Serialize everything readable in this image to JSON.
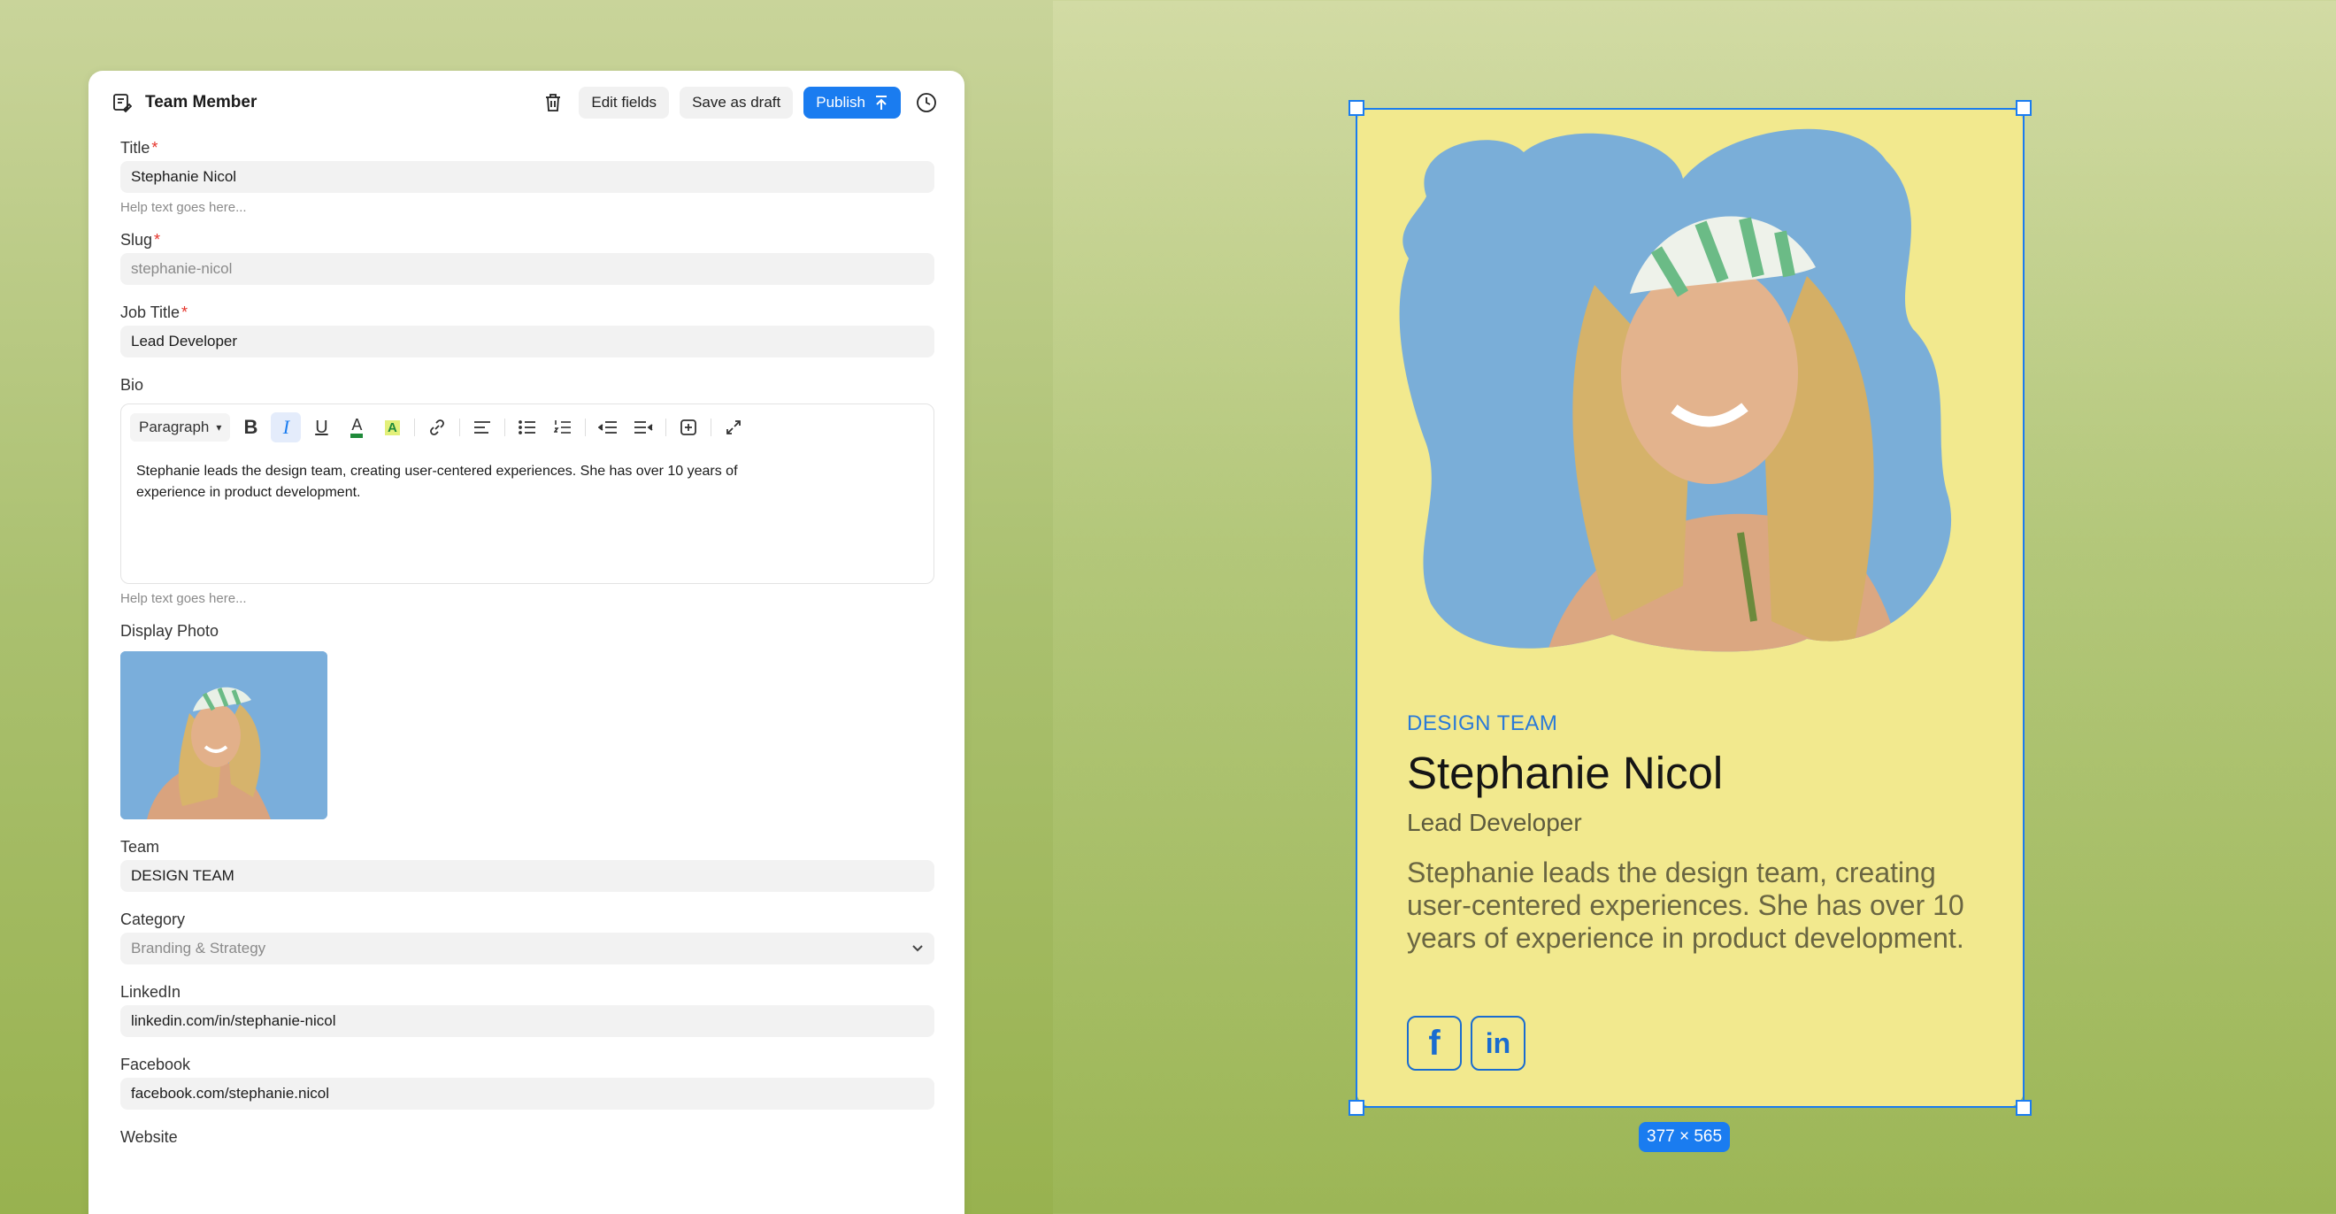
{
  "panel": {
    "title": "Team Member",
    "actions": {
      "edit_fields": "Edit fields",
      "save_draft": "Save as draft",
      "publish": "Publish"
    }
  },
  "fields": {
    "title": {
      "label": "Title",
      "value": "Stephanie Nicol",
      "help": "Help text goes here..."
    },
    "slug": {
      "label": "Slug",
      "value": "stephanie-nicol"
    },
    "job_title": {
      "label": "Job Title",
      "value": "Lead Developer"
    },
    "bio": {
      "label": "Bio",
      "format": "Paragraph",
      "line1": "Stephanie leads the design team, creating user-centered experiences. She has over 10 years of",
      "line2": "experience in product development.",
      "help": "Help text goes here..."
    },
    "photo": {
      "label": "Display Photo"
    },
    "team": {
      "label": "Team",
      "value": "DESIGN TEAM"
    },
    "category": {
      "label": "Category",
      "value": "Branding & Strategy"
    },
    "linkedin": {
      "label": "LinkedIn",
      "value": "linkedin.com/in/stephanie-nicol"
    },
    "facebook": {
      "label": "Facebook",
      "value": "facebook.com/stephanie.nicol"
    },
    "website": {
      "label": "Website"
    }
  },
  "required_mark": "*",
  "card": {
    "team": "DESIGN TEAM",
    "name": "Stephanie Nicol",
    "job": "Lead Developer",
    "bio": "Stephanie leads the design team, creating user-centered experiences. She has over 10 years of experience in product development.",
    "social": {
      "facebook": "f",
      "linkedin": "in"
    },
    "dimensions": "377 × 565"
  },
  "colors": {
    "accent": "#1a7cf0",
    "card_bg": "#f2e98e",
    "team_text": "#2a7ad8"
  }
}
